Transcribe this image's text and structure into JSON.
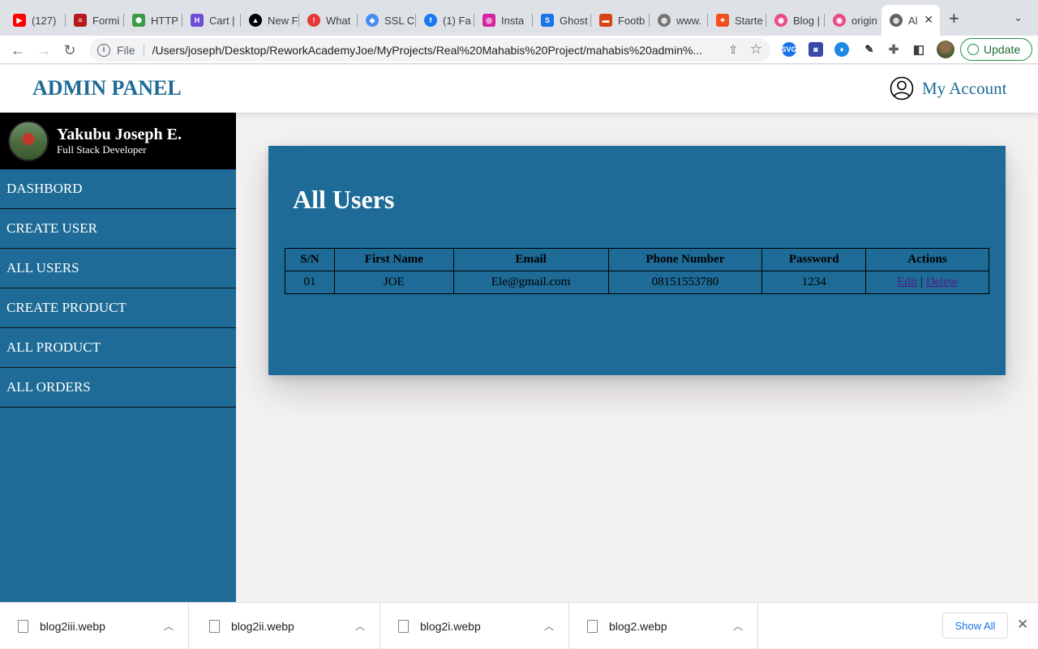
{
  "browser": {
    "tabs": [
      {
        "title": "(127)",
        "color": "#ff0000",
        "glyph": "▶"
      },
      {
        "title": "Formi",
        "color": "#b71c1c",
        "glyph": "≡"
      },
      {
        "title": "HTTP",
        "color": "#3c9a44",
        "glyph": "⬢"
      },
      {
        "title": "Cart |",
        "color": "#6c4cd6",
        "glyph": "H"
      },
      {
        "title": "New F",
        "color": "#000000",
        "glyph": "▲"
      },
      {
        "title": "What",
        "color": "#e53935",
        "glyph": "!"
      },
      {
        "title": "SSL C",
        "color": "#4a8af4",
        "glyph": "◈"
      },
      {
        "title": "(1) Fa",
        "color": "#1877f2",
        "glyph": "f"
      },
      {
        "title": "Insta",
        "color": "#d6249f",
        "glyph": "◎"
      },
      {
        "title": "Ghost",
        "color": "#1a73e8",
        "glyph": "S"
      },
      {
        "title": "Footb",
        "color": "#d84315",
        "glyph": "▬"
      },
      {
        "title": "www.",
        "color": "#757575",
        "glyph": "◍"
      },
      {
        "title": "Starte",
        "color": "#f24e1e",
        "glyph": "✦"
      },
      {
        "title": "Blog |",
        "color": "#ea4c89",
        "glyph": "◉"
      },
      {
        "title": "origin",
        "color": "#ea4c89",
        "glyph": "◉"
      }
    ],
    "active_tab": {
      "title": "Al",
      "close": "✕"
    },
    "new_tab": "+",
    "tab_menu": "⌄",
    "url_scheme": "File",
    "url": "/Users/joseph/Desktop/ReworkAcademyJoe/MyProjects/Real%20Mahabis%20Project/mahabis%20admin%...",
    "update_label": "Update"
  },
  "app": {
    "brand": "ADMIN PANEL",
    "account_label": "My Account"
  },
  "profile": {
    "name": "Yakubu Joseph E.",
    "role": "Full Stack Developer"
  },
  "sidebar": {
    "items": [
      {
        "label": "DASHBORD"
      },
      {
        "label": "CREATE USER"
      },
      {
        "label": "ALL USERS"
      },
      {
        "label": "CREATE PRODUCT"
      },
      {
        "label": "ALL PRODUCT"
      },
      {
        "label": "ALL ORDERS"
      }
    ]
  },
  "main": {
    "title": "All Users",
    "table": {
      "headers": [
        "S/N",
        "First Name",
        "Email",
        "Phone Number",
        "Password",
        "Actions"
      ],
      "rows": [
        {
          "sn": "01",
          "first_name": "JOE",
          "email": "Ele@gmail.com",
          "phone": "08151553780",
          "password": "1234",
          "edit": "Edit",
          "sep": "|",
          "delete": "Delete"
        }
      ]
    }
  },
  "downloads": {
    "items": [
      {
        "name": "blog2iii.webp"
      },
      {
        "name": "blog2ii.webp"
      },
      {
        "name": "blog2i.webp"
      },
      {
        "name": "blog2.webp"
      }
    ],
    "show_all": "Show All",
    "close": "✕"
  },
  "colors": {
    "primary": "#1d6b96",
    "sidebar_profile_bg": "#000000",
    "page_bg": "#f4f1f1"
  }
}
